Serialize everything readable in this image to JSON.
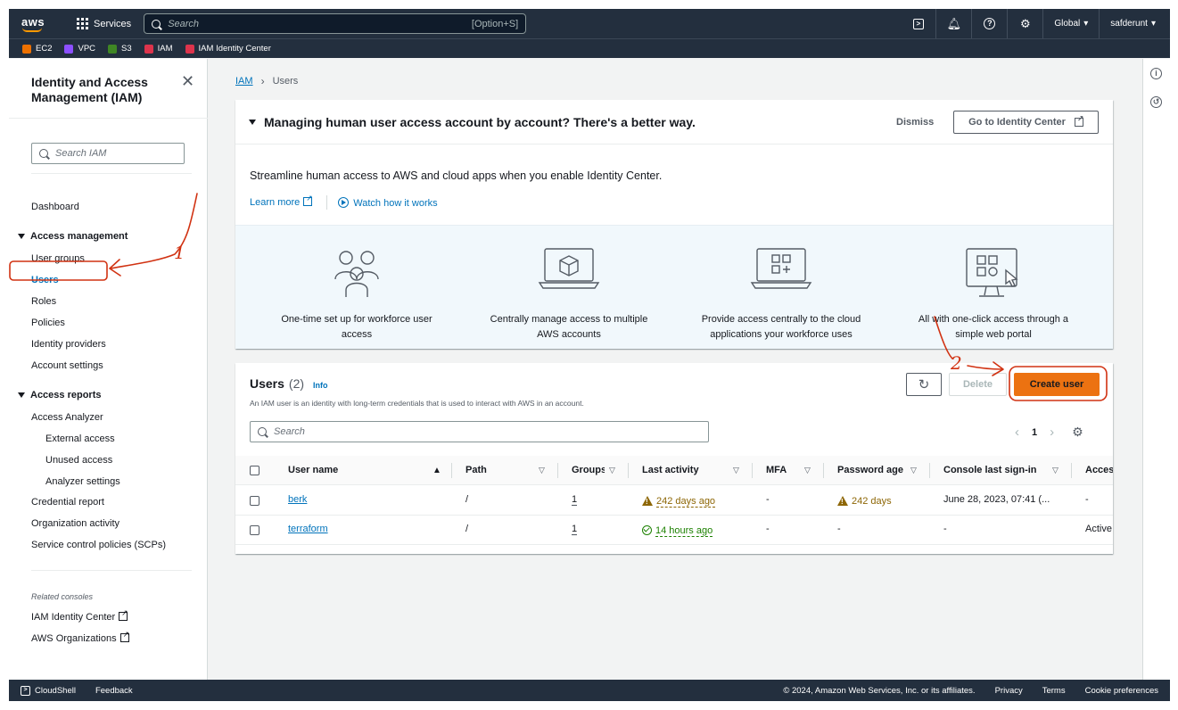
{
  "topbar": {
    "logo": "aws",
    "services_label": "Services",
    "search_placeholder": "Search",
    "search_shortcut": "[Option+S]",
    "icons": [
      "cloudshell-icon",
      "bell-icon",
      "help-icon",
      "gear-icon"
    ],
    "region": "Global",
    "account": "safderunt"
  },
  "favorites": [
    {
      "label": "EC2",
      "color": "#ed7100"
    },
    {
      "label": "VPC",
      "color": "#8c4fff"
    },
    {
      "label": "S3",
      "color": "#3f8624"
    },
    {
      "label": "IAM",
      "color": "#dd344c"
    },
    {
      "label": "IAM Identity Center",
      "color": "#dd344c"
    }
  ],
  "sidenav": {
    "title": "Identity and Access Management (IAM)",
    "search_placeholder": "Search IAM",
    "dashboard": "Dashboard",
    "access_management": {
      "label": "Access management",
      "items": [
        "User groups",
        "Users",
        "Roles",
        "Policies",
        "Identity providers",
        "Account settings"
      ]
    },
    "access_reports": {
      "label": "Access reports",
      "analyzer": "Access Analyzer",
      "analyzer_items": [
        "External access",
        "Unused access",
        "Analyzer settings"
      ],
      "items": [
        "Credential report",
        "Organization activity",
        "Service control policies (SCPs)"
      ]
    },
    "related_label": "Related consoles",
    "related": [
      "IAM Identity Center",
      "AWS Organizations"
    ]
  },
  "breadcrumb": {
    "root": "IAM",
    "current": "Users"
  },
  "promo": {
    "title": "Managing human user access account by account? There's a better way.",
    "dismiss": "Dismiss",
    "cta": "Go to Identity Center",
    "description": "Streamline human access to AWS and cloud apps when you enable Identity Center.",
    "learn_more": "Learn more",
    "watch": "Watch how it works",
    "features": [
      "One-time set up for workforce user access",
      "Centrally manage access to multiple AWS accounts",
      "Provide access centrally to the cloud applications your workforce uses",
      "All with one-click access through a simple web portal"
    ]
  },
  "users_panel": {
    "title": "Users",
    "count": "(2)",
    "info": "Info",
    "description": "An IAM user is an identity with long-term credentials that is used to interact with AWS in an account.",
    "delete": "Delete",
    "create": "Create user",
    "search_placeholder": "Search",
    "page": "1",
    "columns": [
      "User name",
      "Path",
      "Groups",
      "Last activity",
      "MFA",
      "Password age",
      "Console last sign-in",
      "Access"
    ],
    "rows": [
      {
        "user": "berk",
        "path": "/",
        "groups": "1",
        "last_activity": "242 days ago",
        "mfa": "-",
        "password_age": "242 days",
        "console_last": "June 28, 2023, 07:41 (...",
        "access": "-"
      },
      {
        "user": "terraform",
        "path": "/",
        "groups": "1",
        "last_activity": "14 hours ago",
        "mfa": "-",
        "password_age": "-",
        "console_last": "-",
        "access": "Active"
      }
    ]
  },
  "annotations": {
    "step1": "1",
    "step2": "2"
  },
  "footer": {
    "cloudshell": "CloudShell",
    "feedback": "Feedback",
    "copyright": "© 2024, Amazon Web Services, Inc. or its affiliates.",
    "privacy": "Privacy",
    "terms": "Terms",
    "cookies": "Cookie preferences"
  }
}
